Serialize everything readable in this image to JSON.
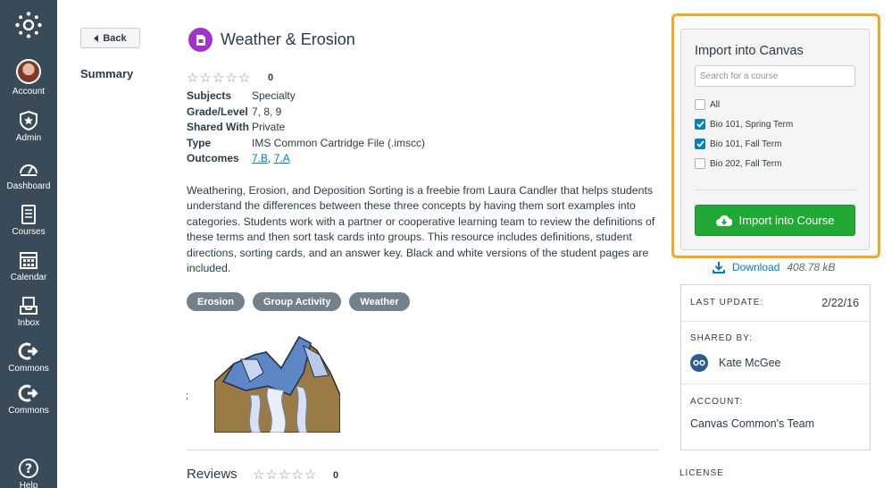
{
  "sidebar": {
    "items": [
      {
        "label": "Account"
      },
      {
        "label": "Admin"
      },
      {
        "label": "Dashboard"
      },
      {
        "label": "Courses"
      },
      {
        "label": "Calendar"
      },
      {
        "label": "Inbox"
      },
      {
        "label": "Commons"
      },
      {
        "label": "Commons"
      },
      {
        "label": "Help"
      }
    ]
  },
  "header": {
    "back_label": "Back",
    "title": "Weather & Erosion"
  },
  "summary_label": "Summary",
  "rating": {
    "count": "0",
    "stars": 0,
    "max": 5
  },
  "meta": {
    "subjects_key": "Subjects",
    "subjects": "Specialty",
    "grade_key": "Grade/Level",
    "grade": "7, 8, 9",
    "shared_key": "Shared With",
    "shared": "Private",
    "type_key": "Type",
    "type": "IMS Common Cartridge File (.imscc)",
    "outcomes_key": "Outcomes",
    "outcomes": [
      "7.B",
      "7.A"
    ],
    "outcomes_sep": ", "
  },
  "description": "Weathering, Erosion, and Deposition Sorting is a freebie from Laura Candler that helps students understand the differences between these three concepts by having them sort examples into categories. Students work with a partner or cooperative learning team to review the definitions of these terms and then sort task cards into groups. This resource includes definitions, student directions, sorting cards, and an answer key. Black and white versions of the student pages are included.",
  "tags": [
    "Erosion",
    "Group Activity",
    "Weather"
  ],
  "stray_char": ";",
  "reviews": {
    "label": "Reviews",
    "count": "0",
    "stars": 0
  },
  "import_panel": {
    "title": "Import into Canvas",
    "search_placeholder": "Search for a course",
    "options": [
      {
        "label": "All",
        "checked": false
      },
      {
        "label": "Bio 101, Spring Term",
        "checked": true
      },
      {
        "label": "Bio 101, Fall Term",
        "checked": true
      },
      {
        "label": "Bio 202, Fall Term",
        "checked": false
      }
    ],
    "button_label": "Import into Course"
  },
  "download": {
    "label": "Download",
    "size": "408.78 kB"
  },
  "info": {
    "last_update_label": "LAST UPDATE:",
    "last_update": "2/22/16",
    "shared_by_label": "SHARED BY:",
    "shared_by": "Kate McGee",
    "account_label": "ACCOUNT:",
    "account": "Canvas Common's Team"
  },
  "license_label": "LICENSE",
  "colors": {
    "sidebar": "#394b58",
    "link": "#0081bd",
    "import_button": "#22a835",
    "highlight_outline": "#f5a623",
    "tag": "#73818c",
    "resource_icon": "#a333c8"
  }
}
